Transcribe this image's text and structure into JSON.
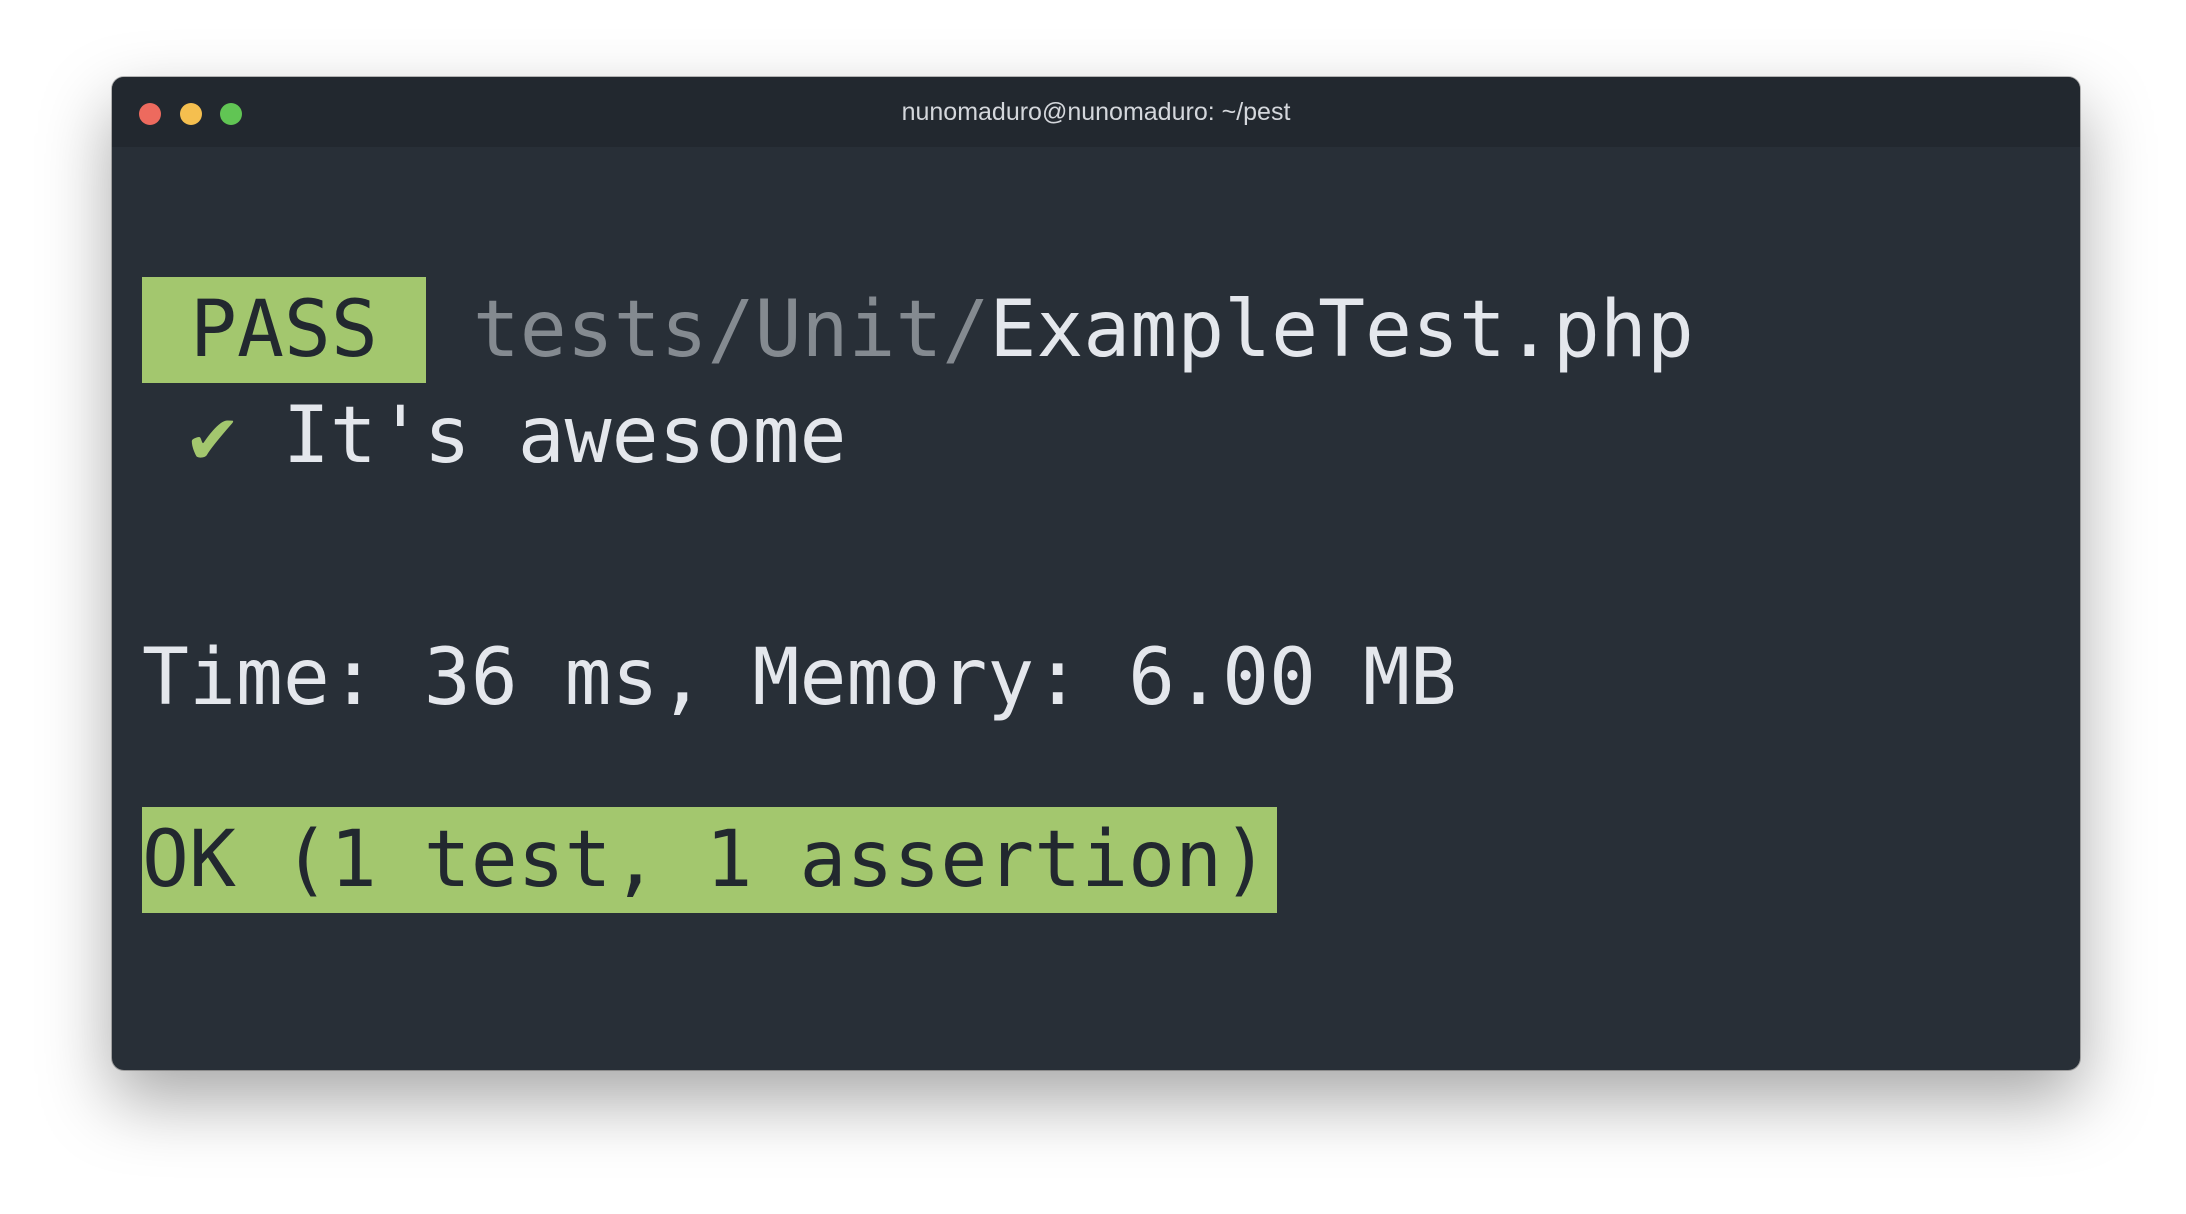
{
  "window": {
    "title": "nunomaduro@nunomaduro: ~/pest"
  },
  "terminal": {
    "pass_label": "PASS",
    "path_dir": "tests/Unit/",
    "path_file": "ExampleTest.php",
    "check_icon": "✔",
    "test_name": "It's awesome",
    "summary": "Time: 36 ms, Memory: 6.00 MB",
    "result": "OK (1 test, 1 assertion)"
  },
  "colors": {
    "background": "#282f37",
    "titlebar": "#22282f",
    "pass_green": "#a3c76e",
    "dim_text": "#848a90",
    "text": "#e4e7ec"
  }
}
